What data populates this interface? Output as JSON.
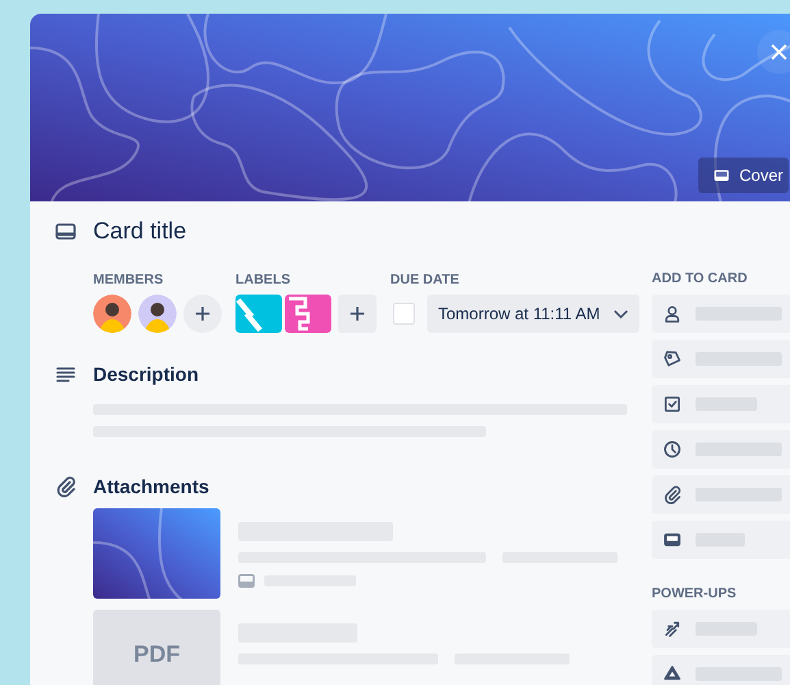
{
  "cover": {
    "button": "Cover"
  },
  "card": {
    "title": "Card title"
  },
  "members": {
    "heading": "MEMBERS",
    "avatars": [
      {
        "color": "#f7896a"
      },
      {
        "color": "#cfcaf6"
      }
    ]
  },
  "labels": {
    "heading": "LABELS",
    "items": [
      {
        "kind": "stripes",
        "color": "#00c2e0"
      },
      {
        "kind": "steps",
        "color": "#f050b4"
      }
    ]
  },
  "due_date": {
    "heading": "DUE DATE",
    "checked": false,
    "value": "Tomorrow at 11:11 AM"
  },
  "description": {
    "heading": "Description"
  },
  "attachments": {
    "heading": "Attachments",
    "items": [
      {
        "kind": "picture"
      },
      {
        "kind": "pdf",
        "label": "PDF"
      }
    ]
  },
  "sidebar": {
    "add_heading": "ADD TO CARD",
    "add_items": [
      {
        "kind": "member"
      },
      {
        "kind": "label"
      },
      {
        "kind": "checklist"
      },
      {
        "kind": "dates"
      },
      {
        "kind": "attachment"
      },
      {
        "kind": "cover"
      }
    ],
    "powerups_heading": "POWER-UPS",
    "powerups": [
      {
        "kind": "arrows"
      },
      {
        "kind": "triangle"
      }
    ]
  }
}
